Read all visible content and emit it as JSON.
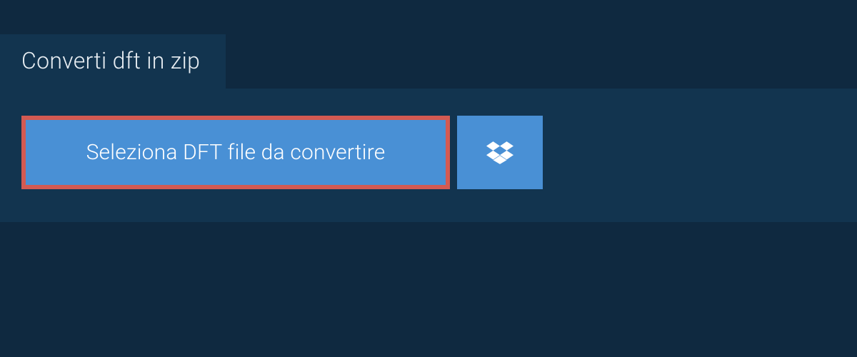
{
  "tab": {
    "label": "Converti dft in zip"
  },
  "actions": {
    "select_file_label": "Seleziona DFT file da convertire"
  },
  "colors": {
    "background": "#0f2940",
    "panel": "#12344f",
    "button_primary": "#4990d5",
    "highlight_border": "#d35a52",
    "text_light": "#e8eef3",
    "text_white": "#ffffff"
  },
  "icons": {
    "dropbox": "dropbox-icon"
  }
}
